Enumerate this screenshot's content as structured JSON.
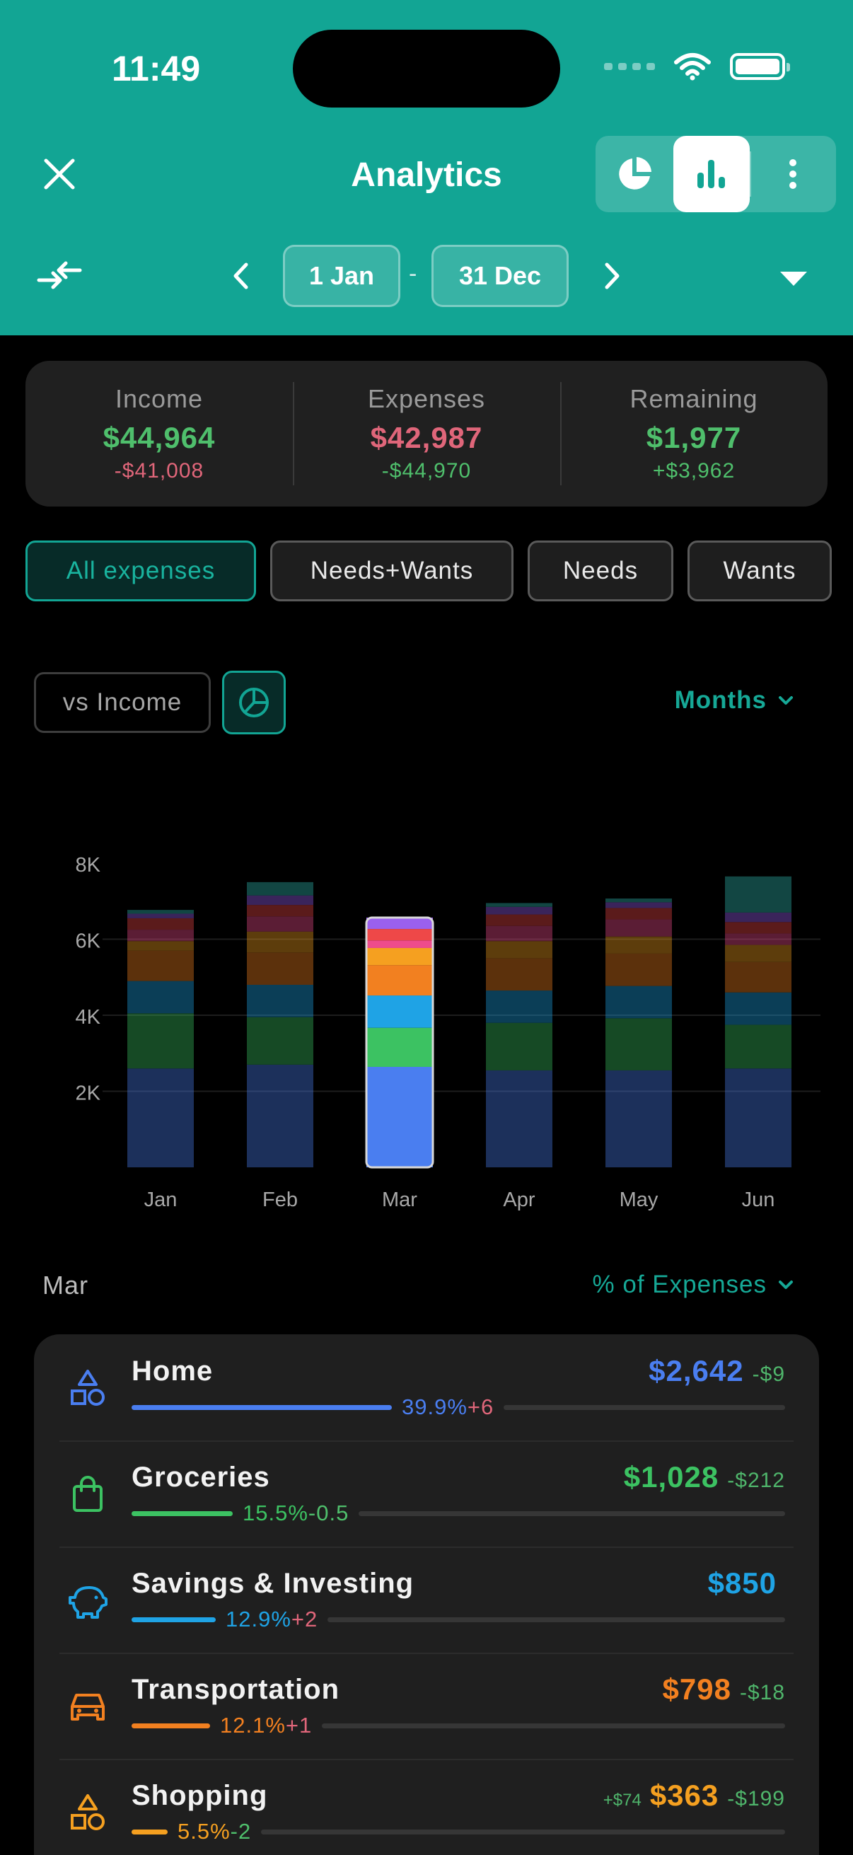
{
  "status": {
    "time": "11:49"
  },
  "header": {
    "title": "Analytics",
    "date_start": "1 Jan",
    "date_separator": "-",
    "date_end": "31 Dec"
  },
  "summary": {
    "income": {
      "label": "Income",
      "value": "$44,964",
      "delta": "-$41,008",
      "value_color": "#4fbf6c",
      "delta_color": "#e0667a"
    },
    "expenses": {
      "label": "Expenses",
      "value": "$42,987",
      "delta": "-$44,970",
      "value_color": "#e0667a",
      "delta_color": "#4fbf6c"
    },
    "remaining": {
      "label": "Remaining",
      "value": "$1,977",
      "delta": "+$3,962",
      "value_color": "#4fbf6c",
      "delta_color": "#4fbf6c"
    }
  },
  "filters": [
    {
      "label": "All expenses",
      "active": true
    },
    {
      "label": "Needs+Wants",
      "active": false
    },
    {
      "label": "Needs",
      "active": false
    },
    {
      "label": "Wants",
      "active": false
    }
  ],
  "chart_controls": {
    "vs_income": "vs Income",
    "period": "Months"
  },
  "chart_data": {
    "type": "bar",
    "stacked": true,
    "categories": [
      "Jan",
      "Feb",
      "Mar",
      "Apr",
      "May",
      "Jun"
    ],
    "selected": "Mar",
    "y_ticks": [
      "8K",
      "6K",
      "4K",
      "2K"
    ],
    "ylim": [
      0,
      8000
    ],
    "series": [
      {
        "color": "#4a7ef0",
        "values": [
          2600,
          2700,
          2642,
          2550,
          2550,
          2600
        ]
      },
      {
        "color": "#3cc262",
        "values": [
          1450,
          1250,
          1028,
          1250,
          1370,
          1150
        ]
      },
      {
        "color": "#1fa3e5",
        "values": [
          850,
          850,
          850,
          850,
          850,
          850
        ]
      },
      {
        "color": "#f28020",
        "values": [
          800,
          850,
          798,
          850,
          850,
          800
        ]
      },
      {
        "color": "#f5a020",
        "values": [
          250,
          550,
          450,
          450,
          450,
          450
        ]
      },
      {
        "color": "#ee4c8c",
        "values": [
          300,
          400,
          200,
          400,
          450,
          300
        ]
      },
      {
        "color": "#ee4848",
        "values": [
          300,
          300,
          300,
          300,
          300,
          300
        ]
      },
      {
        "color": "#9a60ee",
        "values": [
          120,
          250,
          300,
          200,
          150,
          250
        ]
      },
      {
        "color": "#30b8b0",
        "values": [
          100,
          350,
          0,
          100,
          100,
          950
        ]
      }
    ]
  },
  "breakdown": {
    "month": "Mar",
    "metric": "% of Expenses",
    "items": [
      {
        "name": "Home",
        "icon": "shapes-icon",
        "amount": "$2,642",
        "delta": "-$9",
        "pre": "",
        "pct": "39.9%",
        "pct_delta": "+6",
        "pct_delta_color": "#e0667a",
        "color": "#4a7ef0",
        "fill": 0.4
      },
      {
        "name": "Groceries",
        "icon": "shopping-bag-icon",
        "amount": "$1,028",
        "delta": "-$212",
        "pre": "",
        "pct": "15.5%",
        "pct_delta": "-0.5",
        "pct_delta_color": "#4fbf6c",
        "color": "#3cc262",
        "fill": 0.155
      },
      {
        "name": "Savings & Investing",
        "icon": "piggy-bank-icon",
        "amount": "$850",
        "delta": "",
        "pre": "",
        "pct": "12.9%",
        "pct_delta": "+2",
        "pct_delta_color": "#e0667a",
        "color": "#1fa3e5",
        "fill": 0.129
      },
      {
        "name": "Transportation",
        "icon": "car-icon",
        "amount": "$798",
        "delta": "-$18",
        "pre": "",
        "pct": "12.1%",
        "pct_delta": "+1",
        "pct_delta_color": "#e0667a",
        "color": "#f28020",
        "fill": 0.121
      },
      {
        "name": "Shopping",
        "icon": "shapes-icon",
        "amount": "$363",
        "delta": "-$199",
        "pre": "+$74",
        "pct": "5.5%",
        "pct_delta": "-2",
        "pct_delta_color": "#4fbf6c",
        "color": "#f5a020",
        "fill": 0.055
      }
    ]
  }
}
